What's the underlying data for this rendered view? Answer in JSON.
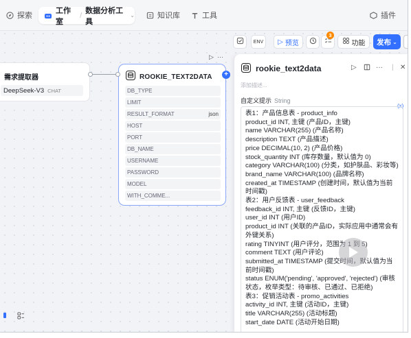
{
  "nav": {
    "explore": "探索",
    "studio": "工作室",
    "tool_name": "数据分析工具",
    "knowledge": "知识库",
    "tools": "工具",
    "plugins": "插件"
  },
  "toolbar": {
    "preview": "预览",
    "badge_count": "3",
    "features": "功能",
    "publish": "发布"
  },
  "left_node": {
    "title": "需求提取器",
    "model": "DeepSeek-V3",
    "model_tag": "CHAT"
  },
  "main_node": {
    "title": "ROOKIE_TEXT2DATA",
    "params": [
      {
        "name": "DB_TYPE",
        "value": ""
      },
      {
        "name": "LIMIT",
        "value": ""
      },
      {
        "name": "RESULT_FORMAT",
        "value": "json"
      },
      {
        "name": "HOST",
        "value": ""
      },
      {
        "name": "PORT",
        "value": ""
      },
      {
        "name": "DB_NAME",
        "value": ""
      },
      {
        "name": "USERNAME",
        "value": ""
      },
      {
        "name": "PASSWORD",
        "value": ""
      },
      {
        "name": "MODEL",
        "value": ""
      },
      {
        "name": "WITH_COMME...",
        "value": ""
      }
    ]
  },
  "panel": {
    "title": "rookie_text2data",
    "desc_placeholder": "添加描述...",
    "field_label": "自定义提示",
    "field_type": "String",
    "var_hint": "(x)",
    "lines": [
      "表1：产品信息表 - product_info",
      "product_id INT, 主键 (产品ID，主键)",
      "name VARCHAR(255) (产品名称)",
      "description TEXT (产品描述)",
      "price DECIMAL(10, 2) (产品价格)",
      "stock_quantity INT (库存数量，默认值为 0)",
      "category VARCHAR(100) (分类，如护肤品、彩妆等)",
      "brand_name VARCHAR(100) (品牌名称)",
      "created_at TIMESTAMP (创建时间，默认值为当前时间戳)",
      "表2：用户反馈表 - user_feedback",
      "feedback_id INT, 主键 (反馈ID，主键)",
      "user_id INT (用户ID)",
      "product_id INT (关联的产品ID，实际应用中通常会有外键关系)",
      "rating TINYINT (用户评分，范围为 1 到 5)",
      "comment TEXT (用户评论)",
      "submitted_at TIMESTAMP (提交时间，默认值为当前时间戳)",
      "status ENUM('pending', 'approved', 'rejected') (审核状态，枚举类型：待审核、已通过、已拒绝)",
      "表3：促销活动表 - promo_activities",
      "activity_id INT, 主键 (活动ID，主键)",
      "title VARCHAR(255) (活动标题)",
      "start_date DATE (活动开始日期)"
    ]
  },
  "colors": {
    "accent": "#3370ff",
    "badge": "#ff8a00",
    "node_border": "#8aa6f8"
  }
}
